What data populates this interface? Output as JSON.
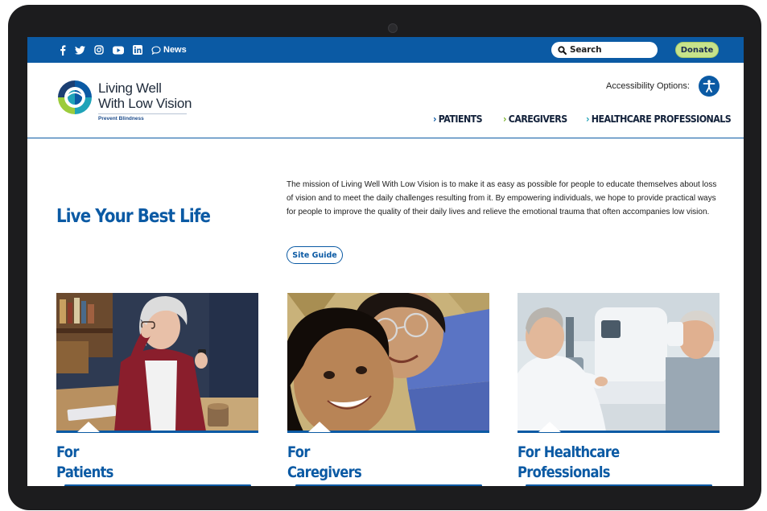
{
  "topbar": {
    "social": [
      {
        "name": "facebook-icon",
        "glyph": "f"
      },
      {
        "name": "twitter-icon"
      },
      {
        "name": "instagram-icon"
      },
      {
        "name": "youtube-icon"
      },
      {
        "name": "linkedin-icon"
      }
    ],
    "news_label": "News",
    "search_label": "Search",
    "donate_label": "Donate"
  },
  "header": {
    "logo_line1": "Living Well",
    "logo_line2": "With Low Vision",
    "logo_tagline": "Prevent Blindness",
    "accessibility_label": "Accessibility Options:",
    "nav": [
      {
        "label": "PATIENTS"
      },
      {
        "label": "CAREGIVERS"
      },
      {
        "label": "HEALTHCARE PROFESSIONALS"
      }
    ]
  },
  "hero": {
    "title": "Live Your Best Life",
    "mission": "The mission of Living Well With Low Vision is to make it as easy as possible for people to educate themselves about loss of vision and to meet the daily challenges resulting from it. By empowering individuals, we hope to provide practical ways for people to improve the quality of their daily lives and relieve the emotional trauma that often accompanies low vision.",
    "site_guide_label": "Site Guide"
  },
  "cards": [
    {
      "line1": "For",
      "line2": "Patients"
    },
    {
      "line1": "For",
      "line2": "Caregivers"
    },
    {
      "line1": "For Healthcare",
      "line2": "Professionals"
    }
  ],
  "colors": {
    "brand_blue": "#0b5aa4",
    "donate_green": "#c7e38a",
    "caregivers_chevron": "#7bb32e",
    "professionals_chevron": "#1fa3b8"
  }
}
